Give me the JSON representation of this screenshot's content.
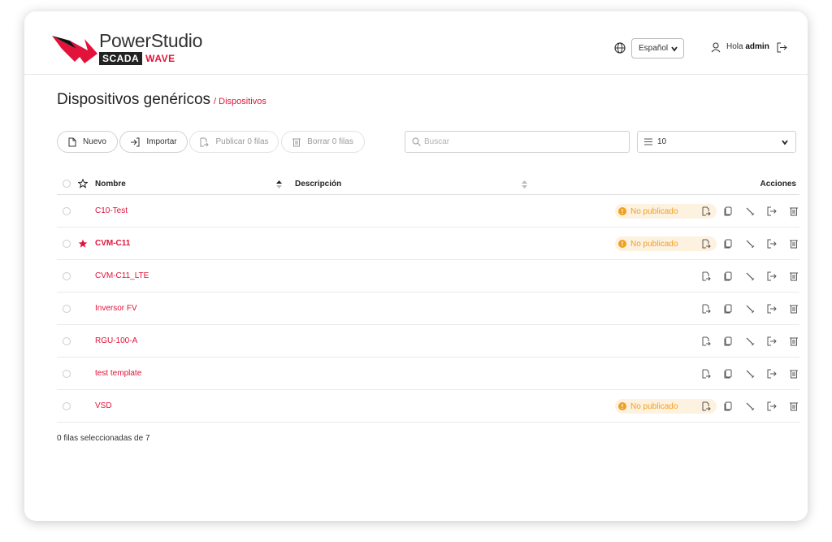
{
  "brand": {
    "name": "PowerStudio",
    "sub1": "SCADA",
    "sub2": "WAVE"
  },
  "header": {
    "language": "Español",
    "greeting": "Hola",
    "username": "admin"
  },
  "page": {
    "title": "Dispositivos genéricos",
    "breadcrumb": "/ Dispositivos"
  },
  "toolbar": {
    "new_label": "Nuevo",
    "import_label": "Importar",
    "publish_label": "Publicar 0 filas",
    "delete_label": "Borrar 0 filas",
    "search_placeholder": "Buscar",
    "page_size": "10"
  },
  "table": {
    "columns": {
      "name": "Nombre",
      "description": "Descripción",
      "actions": "Acciones"
    },
    "rows": [
      {
        "name": "C10-Test",
        "favorite": false,
        "status": "No publicado"
      },
      {
        "name": "CVM-C11",
        "favorite": true,
        "status": "No publicado"
      },
      {
        "name": "CVM-C11_LTE",
        "favorite": false,
        "status": ""
      },
      {
        "name": "Inversor FV",
        "favorite": false,
        "status": ""
      },
      {
        "name": "RGU-100-A",
        "favorite": false,
        "status": ""
      },
      {
        "name": "test template",
        "favorite": false,
        "status": ""
      },
      {
        "name": "VSD",
        "favorite": false,
        "status": "No publicado"
      }
    ]
  },
  "footer": {
    "selection": "0 filas seleccionadas de 7"
  },
  "colors": {
    "accent": "#e2123a",
    "warning": "#f0a020"
  }
}
